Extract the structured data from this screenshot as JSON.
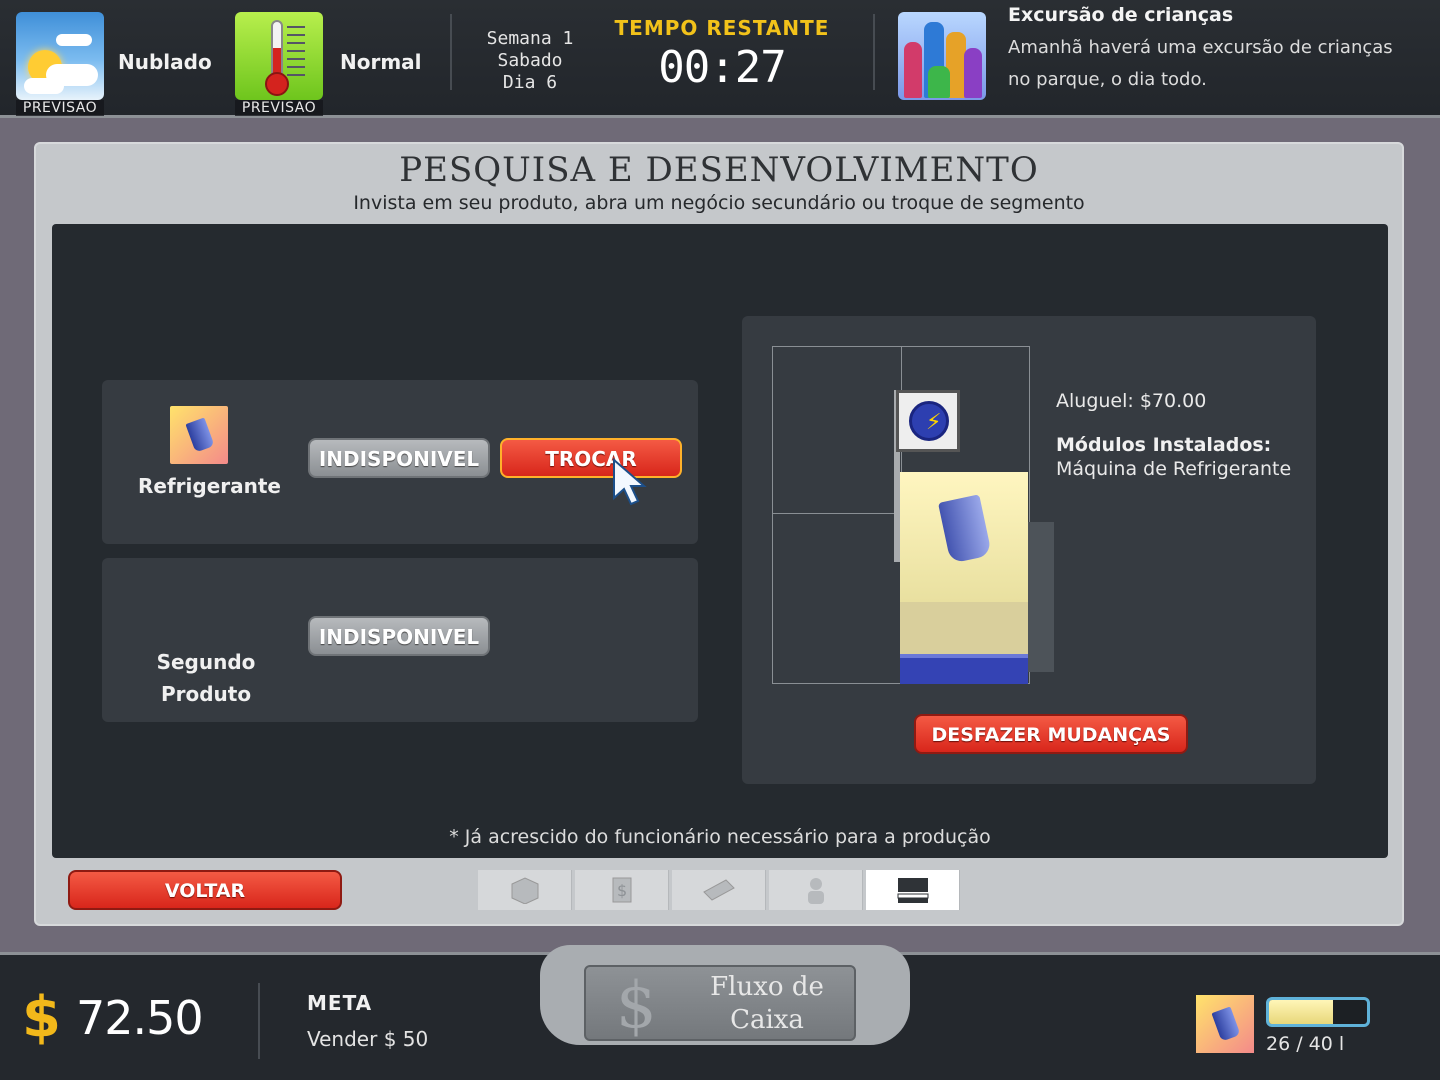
{
  "topbar": {
    "forecast1": {
      "label": "Nublado",
      "caption": "PREVISAO"
    },
    "forecast2": {
      "label": "Normal",
      "caption": "PREVISAO"
    },
    "date": {
      "week": "Semana 1",
      "weekday": "Sabado",
      "day": "Dia 6"
    },
    "timer": {
      "label": "TEMPO RESTANTE",
      "value": "00:27"
    },
    "event": {
      "title": "Excursão de crianças",
      "line1": "Amanhã haverá uma excursão de crianças",
      "line2": "no parque, o dia todo."
    }
  },
  "panel": {
    "title": "PESQUISA E DESENVOLVIMENTO",
    "subtitle": "Invista em seu produto, abra um negócio secundário ou troque de segmento",
    "product1": {
      "name": "Refrigerante",
      "status_button": "INDISPONIVEL",
      "action_button": "TROCAR"
    },
    "product2": {
      "name_line1": "Segundo",
      "name_line2": "Produto",
      "status_button": "INDISPONIVEL"
    },
    "preview": {
      "rent": "Aluguel: $70.00",
      "modules_label": "Módulos Instalados:",
      "modules_value": "Máquina de Refrigerante",
      "undo_button": "DESFAZER MUDANÇAS"
    },
    "footnote": "* Já acrescido do funcionário necessário para a produção",
    "back_button": "VOLTAR",
    "tabs": [
      {
        "icon": "box-icon",
        "active": false
      },
      {
        "icon": "money-document-icon",
        "active": false
      },
      {
        "icon": "keyboard-icon",
        "active": false
      },
      {
        "icon": "person-icon",
        "active": false
      },
      {
        "icon": "stand-icon",
        "active": true
      }
    ]
  },
  "bottombar": {
    "currency_symbol": "$",
    "money": "72.50",
    "goal_label": "META",
    "goal_value": "Vender $ 50",
    "cashflow_line1": "Fluxo de",
    "cashflow_line2": "Caixa",
    "stock_text": "26 / 40 l",
    "stock_level": 0.65
  },
  "colors": {
    "accent_yellow": "#f2c21a",
    "button_red": "#d8261b",
    "button_gray": "#8b8f93",
    "panel_dark": "#252a2f"
  }
}
